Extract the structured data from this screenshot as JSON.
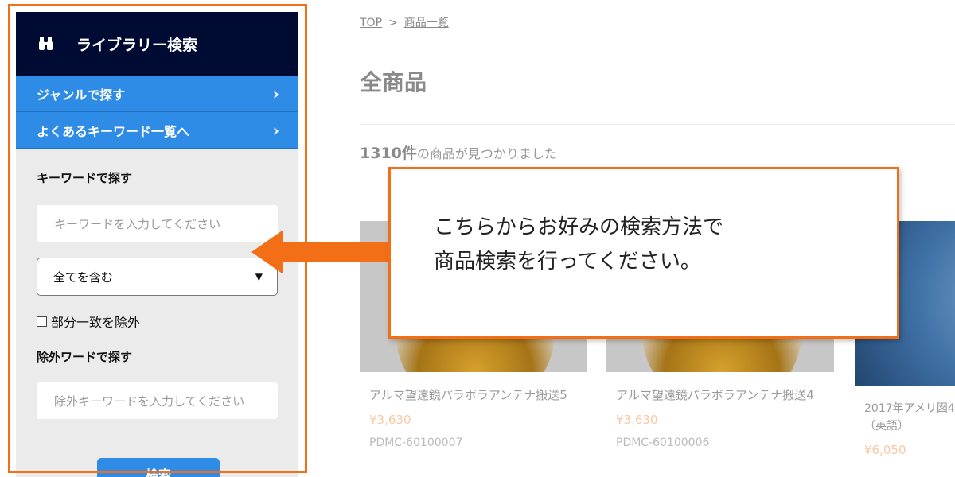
{
  "sidebar": {
    "title": "ライブラリー検索",
    "links": [
      {
        "label": "ジャンルで探す",
        "icon": "chevron-right"
      },
      {
        "label": "よくあるキーワード一覧へ",
        "icon": "chevron-right"
      }
    ],
    "keyword_label": "キーワードで探す",
    "keyword_placeholder": "キーワードを入力してください",
    "match_select_value": "全てを含む",
    "exclude_partial_label": "部分一致を除外",
    "exclude_label": "除外ワードで探す",
    "exclude_placeholder": "除外キーワードを入力してください",
    "search_button": "検索"
  },
  "breadcrumb": {
    "top": "TOP",
    "separator": ">",
    "current": "商品一覧"
  },
  "page_title": "全商品",
  "result": {
    "count": "1310件",
    "suffix": "の商品が見つかりました"
  },
  "products": [
    {
      "name": "アルマ望遠鏡パラボラアンテナ搬送5",
      "price": "¥3,630",
      "code": "PDMC-60100007"
    },
    {
      "name": "アルマ望遠鏡パラボラアンテナ搬送4",
      "price": "¥3,630",
      "code": "PDMC-60100006"
    },
    {
      "name": "2017年アメリ図4（英語）",
      "price": "¥6,050",
      "code": ""
    }
  ],
  "callout": {
    "line1": "こちらからお好みの検索方法で",
    "line2": "商品検索を行ってください。"
  },
  "colors": {
    "accent_orange": "#f26f18",
    "nav_blue": "#2f8ce6",
    "header_navy": "#000b33"
  }
}
